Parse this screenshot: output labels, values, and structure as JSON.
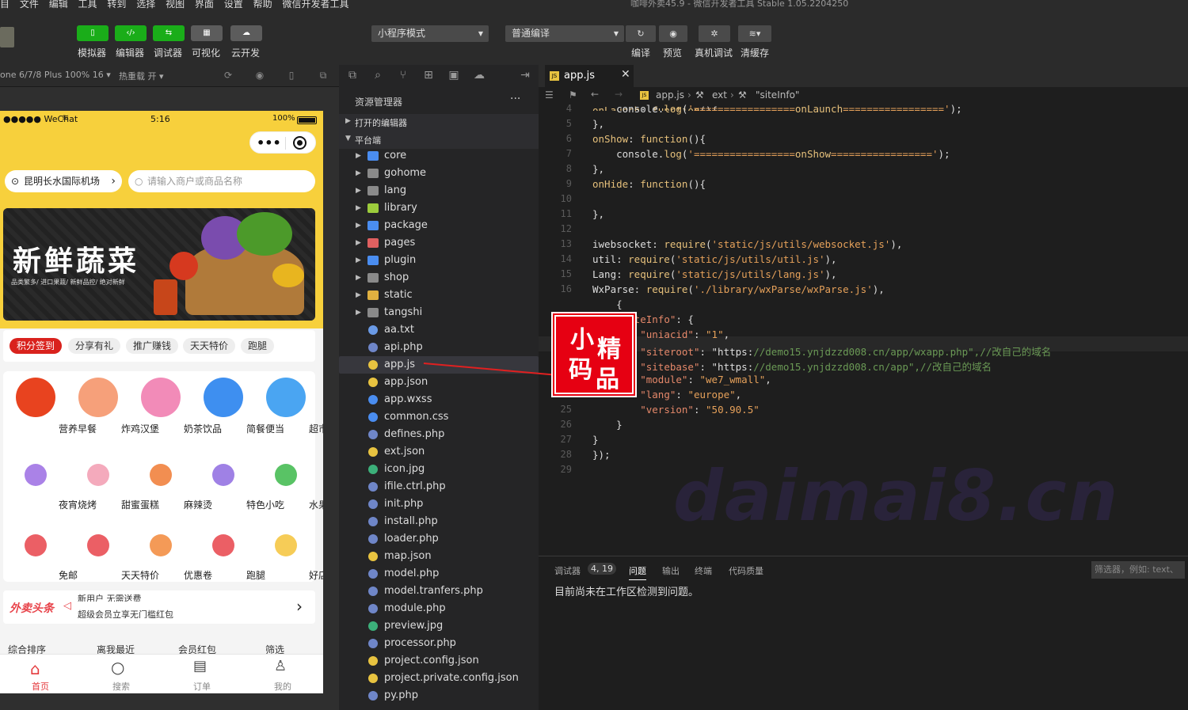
{
  "menu": [
    "目",
    "文件",
    "编辑",
    "工具",
    "转到",
    "选择",
    "视图",
    "界面",
    "设置",
    "帮助",
    "微信开发者工具"
  ],
  "window_title": "咖啡外卖45.9 - 微信开发者工具 Stable 1.05.2204250",
  "toolbar": {
    "buttons": [
      {
        "icon": "phone-icon",
        "label": "模拟器"
      },
      {
        "icon": "code-icon",
        "label": "编辑器"
      },
      {
        "icon": "debug-icon",
        "label": "调试器"
      },
      {
        "icon": "layout-icon",
        "label": "可视化"
      },
      {
        "icon": "cloud-icon",
        "label": "云开发"
      }
    ],
    "mode_select": "小程序模式",
    "compile_select": "普通编译",
    "actions": [
      {
        "icon": "refresh-icon",
        "label": "编译"
      },
      {
        "icon": "eye-icon",
        "label": "预览"
      },
      {
        "icon": "bug-icon",
        "label": "真机调试"
      },
      {
        "icon": "layers-icon",
        "label": "清缓存"
      }
    ]
  },
  "simbar": {
    "device": "one 6/7/8 Plus 100% 16 ▾",
    "hotreload": "热重载 开 ▾"
  },
  "phone": {
    "status": {
      "carrier": "●●●●● WeChat",
      "time": "5:16",
      "battery": "100%"
    },
    "location": "昆明长水国际机场",
    "search_placeholder": "请输入商户或商品名称",
    "banner": {
      "title": "新鲜蔬菜",
      "subtitle": "品类繁多/ 进口果蔬/ 新鲜品控/ 绝对新鲜"
    },
    "tags": [
      "积分签到",
      "分享有礼",
      "推广赚钱",
      "天天特价",
      "跑腿"
    ],
    "categories": [
      {
        "label": "营养早餐",
        "icon": "breakfast-icon",
        "color": "#e8431f"
      },
      {
        "label": "炸鸡汉堡",
        "icon": "chicken-icon",
        "color": "#f6a07a"
      },
      {
        "label": "奶茶饮品",
        "icon": "milktea-icon",
        "color": "#f28bb8"
      },
      {
        "label": "简餐便当",
        "icon": "bento-icon",
        "color": "#3e8ff0"
      },
      {
        "label": "超市便利",
        "icon": "supermarket-icon",
        "color": "#4aa5f2"
      },
      {
        "label": "夜宵烧烤",
        "icon": "moon-icon",
        "color": "#9b6ce3"
      },
      {
        "label": "甜蜜蛋糕",
        "icon": "cake-icon",
        "color": "#f29bb0"
      },
      {
        "label": "麻辣烫",
        "icon": "hotpot-icon",
        "color": "#f07a32"
      },
      {
        "label": "特色小吃",
        "icon": "snack-icon",
        "color": "#8e6be0"
      },
      {
        "label": "水果蔬菜",
        "icon": "vegetable-icon",
        "color": "#3cb84a"
      },
      {
        "label": "免邮",
        "icon": "free-shipping-icon",
        "color": "#e8434a"
      },
      {
        "label": "天天特价",
        "icon": "price-tag-icon",
        "color": "#e8434a"
      },
      {
        "label": "优惠卷",
        "icon": "coupon-icon",
        "color": "#f2883a"
      },
      {
        "label": "跑腿",
        "icon": "runner-icon",
        "color": "#e8434a"
      },
      {
        "label": "好店",
        "icon": "store-icon",
        "color": "#f5c33a"
      }
    ],
    "notice": {
      "brand": "外卖头条",
      "line1": "新用户 无需送费",
      "line2": "超级会员立享无门槛红包"
    },
    "sort": [
      "综合排序",
      "离我最近",
      "会员红包",
      "筛选"
    ],
    "tabs": [
      {
        "label": "首页",
        "icon": "home-icon"
      },
      {
        "label": "搜索",
        "icon": "search-icon"
      },
      {
        "label": "订单",
        "icon": "order-icon"
      },
      {
        "label": "我的",
        "icon": "user-icon"
      }
    ]
  },
  "explorer": {
    "title": "资源管理器",
    "more": "···",
    "sections": [
      "打开的编辑器",
      "平台端"
    ],
    "files": [
      {
        "name": "core",
        "type": "folder",
        "color": "#4a8df0"
      },
      {
        "name": "gohome",
        "type": "folder",
        "color": "#8a8a8a"
      },
      {
        "name": "lang",
        "type": "folder",
        "color": "#8a8a8a"
      },
      {
        "name": "library",
        "type": "folder",
        "color": "#9ccc3c"
      },
      {
        "name": "package",
        "type": "folder",
        "color": "#4a8df0"
      },
      {
        "name": "pages",
        "type": "folder",
        "color": "#e06060"
      },
      {
        "name": "plugin",
        "type": "folder",
        "color": "#4a8df0"
      },
      {
        "name": "shop",
        "type": "folder",
        "color": "#8a8a8a"
      },
      {
        "name": "static",
        "type": "folder",
        "color": "#e0b040"
      },
      {
        "name": "tangshi",
        "type": "folder",
        "color": "#8a8a8a"
      },
      {
        "name": "aa.txt",
        "type": "file",
        "color": "#6a9ae6"
      },
      {
        "name": "api.php",
        "type": "file",
        "color": "#6f86c8"
      },
      {
        "name": "app.js",
        "type": "file",
        "color": "#e8c340"
      },
      {
        "name": "app.json",
        "type": "file",
        "color": "#e8c340"
      },
      {
        "name": "app.wxss",
        "type": "file",
        "color": "#4a8df0"
      },
      {
        "name": "common.css",
        "type": "file",
        "color": "#4a8df0"
      },
      {
        "name": "defines.php",
        "type": "file",
        "color": "#6f86c8"
      },
      {
        "name": "ext.json",
        "type": "file",
        "color": "#e8c340"
      },
      {
        "name": "icon.jpg",
        "type": "file",
        "color": "#3cb07a"
      },
      {
        "name": "ifile.ctrl.php",
        "type": "file",
        "color": "#6f86c8"
      },
      {
        "name": "init.php",
        "type": "file",
        "color": "#6f86c8"
      },
      {
        "name": "install.php",
        "type": "file",
        "color": "#6f86c8"
      },
      {
        "name": "loader.php",
        "type": "file",
        "color": "#6f86c8"
      },
      {
        "name": "map.json",
        "type": "file",
        "color": "#e8c340"
      },
      {
        "name": "model.php",
        "type": "file",
        "color": "#6f86c8"
      },
      {
        "name": "model.tranfers.php",
        "type": "file",
        "color": "#6f86c8"
      },
      {
        "name": "module.php",
        "type": "file",
        "color": "#6f86c8"
      },
      {
        "name": "preview.jpg",
        "type": "file",
        "color": "#3cb07a"
      },
      {
        "name": "processor.php",
        "type": "file",
        "color": "#6f86c8"
      },
      {
        "name": "project.config.json",
        "type": "file",
        "color": "#e8c340"
      },
      {
        "name": "project.private.config.json",
        "type": "file",
        "color": "#e8c340"
      },
      {
        "name": "py.php",
        "type": "file",
        "color": "#6f86c8"
      }
    ],
    "selected": "app.js"
  },
  "editor": {
    "tab": "app.js",
    "breadcrumb": [
      "app.js",
      "ext",
      "\"siteInfo\""
    ],
    "lines": [
      {
        "n": "",
        "t": "onLaunch: function(){"
      },
      {
        "n": "4",
        "t": "    console.log('=================onLaunch=================');"
      },
      {
        "n": "5",
        "t": "},"
      },
      {
        "n": "6",
        "t": "onShow: function(){"
      },
      {
        "n": "7",
        "t": "    console.log('=================onShow=================');"
      },
      {
        "n": "8",
        "t": "},"
      },
      {
        "n": "9",
        "t": "onHide: function(){"
      },
      {
        "n": "10",
        "t": ""
      },
      {
        "n": "11",
        "t": "},"
      },
      {
        "n": "12",
        "t": ""
      },
      {
        "n": "13",
        "t": "iwebsocket: require('static/js/utils/websocket.js'),"
      },
      {
        "n": "14",
        "t": "util: require('static/js/utils/util.js'),"
      },
      {
        "n": "15",
        "t": "Lang: require('static/js/utils/lang.js'),"
      },
      {
        "n": "16",
        "t": "WxParse: require('./library/wxParse/wxParse.js'),"
      },
      {
        "n": "",
        "t": "    {"
      },
      {
        "n": "",
        "t": "    \"siteInfo\": {"
      },
      {
        "n": "",
        "t": "        \"uniacid\": \"1\","
      },
      {
        "n": "",
        "t": "        \"siteroot\": \"https://demo15.ynjdzzd008.cn/app/wxapp.php\",//改自己的域名"
      },
      {
        "n": "",
        "t": "        \"sitebase\": \"https://demo15.ynjdzzd008.cn/app\",//改自己的域名"
      },
      {
        "n": "23",
        "t": "        \"module\": \"we7_wmall\","
      },
      {
        "n": "24",
        "t": "        \"lang\": \"europe\","
      },
      {
        "n": "25",
        "t": "        \"version\": \"50.90.5\""
      },
      {
        "n": "26",
        "t": "    }"
      },
      {
        "n": "27",
        "t": "}"
      },
      {
        "n": "28",
        "t": "});"
      },
      {
        "n": "29",
        "t": ""
      }
    ]
  },
  "panel": {
    "tabs": [
      "调试器",
      "4, 19",
      "问题",
      "输出",
      "终端",
      "代码质量"
    ],
    "active": "问题",
    "filter_placeholder": "筛选器，例如: text、",
    "message": "目前尚未在工作区检测到问题。"
  },
  "watermark": "daimai8.cn",
  "stamp": [
    "小",
    "精",
    "码",
    "品"
  ],
  "colors": {
    "green": "#1aad19",
    "yellow": "#f7d03c",
    "red": "#d9221d",
    "keyword": "#e6c07b",
    "string": "#e6a15a",
    "url": "#e5886a",
    "comment": "#6a9955"
  }
}
